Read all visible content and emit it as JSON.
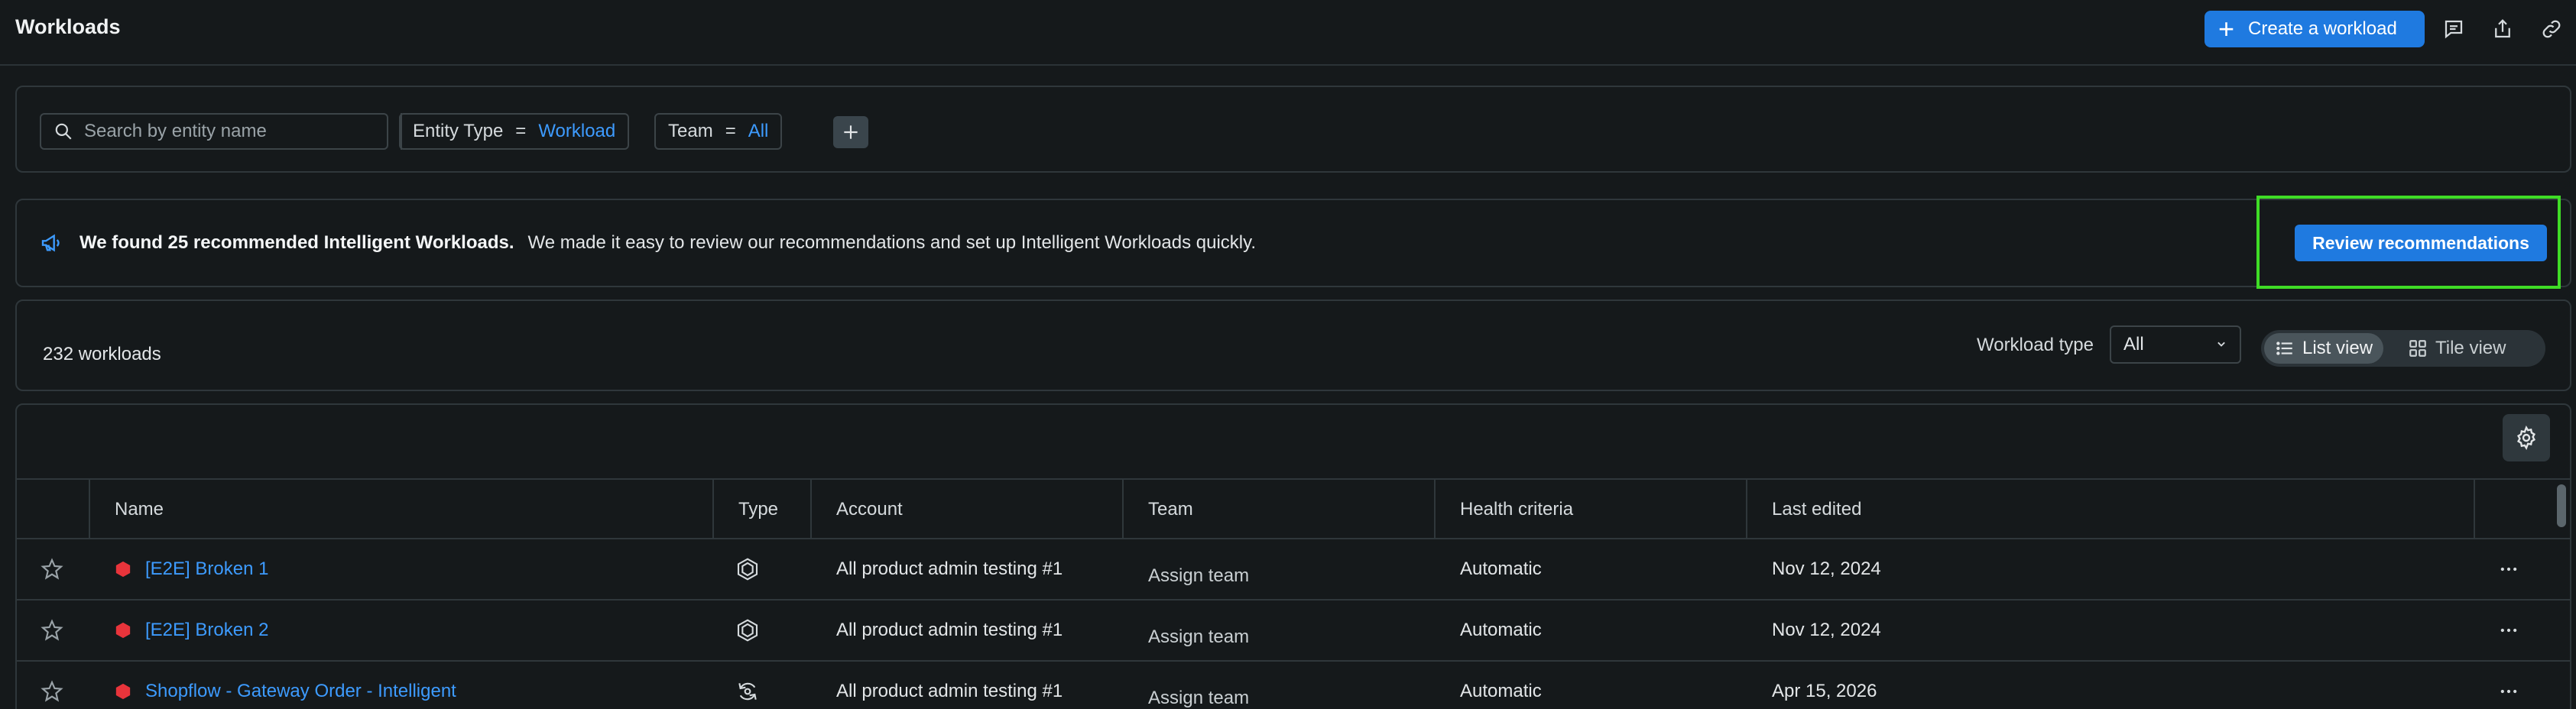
{
  "header": {
    "title": "Workloads",
    "create_button": "Create a workload",
    "icons": [
      "feedback-icon",
      "share-icon",
      "link-icon"
    ]
  },
  "filters": {
    "search_placeholder": "Search by entity name",
    "chips": [
      {
        "key": "Entity Type",
        "op": "=",
        "value": "Workload"
      },
      {
        "key": "Team",
        "op": "=",
        "value": "All"
      }
    ]
  },
  "banner": {
    "bold": "We found 25 recommended Intelligent Workloads.",
    "text": "We made it easy to review our recommendations and set up Intelligent Workloads quickly.",
    "button": "Review recommendations",
    "highlight_color": "#3fdc26"
  },
  "summary": {
    "count": "232 workloads",
    "workload_type_label": "Workload type",
    "workload_type_value": "All",
    "list_view": "List view",
    "tile_view": "Tile view"
  },
  "table": {
    "columns": [
      "Name",
      "Type",
      "Account",
      "Team",
      "Health criteria",
      "Last edited"
    ],
    "rows": [
      {
        "name": "[E2E] Broken 1",
        "type_icon": "workload-icon",
        "account": "All product admin testing #1",
        "team": "Assign team",
        "health": "Automatic",
        "edited": "Nov 12, 2024"
      },
      {
        "name": "[E2E] Broken 2",
        "type_icon": "workload-icon",
        "account": "All product admin testing #1",
        "team": "Assign team",
        "health": "Automatic",
        "edited": "Nov 12, 2024"
      },
      {
        "name": "Shopflow - Gateway Order - Intelligent",
        "type_icon": "intelligent-workload-icon",
        "account": "All product admin testing #1",
        "team": "Assign team",
        "health": "Automatic",
        "edited": "Apr 15, 2026"
      }
    ]
  },
  "colors": {
    "accent": "#1f7ae0",
    "link": "#3d9bff",
    "critical": "#e8343b",
    "background": "#15191b"
  }
}
